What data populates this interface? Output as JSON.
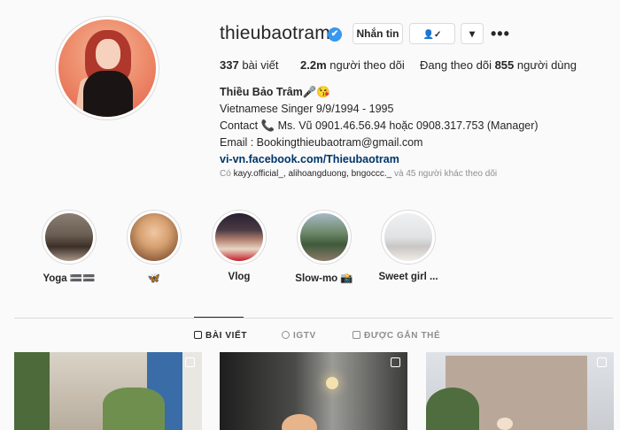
{
  "profile": {
    "username": "thieubaotram",
    "verified_mark": "✔",
    "message_button": "Nhắn tin",
    "follow_icon": "👤✓",
    "dropdown_icon": "▾",
    "more_icon": "•••",
    "stats": {
      "posts_count": "337",
      "posts_label": " bài viết",
      "followers_count": "2.2m",
      "followers_label": " người theo dõi",
      "following_prefix": "Đang theo dõi ",
      "following_count": "855",
      "following_label": " người dùng"
    },
    "bio": {
      "name": "Thiều Bảo Trâm🎤😘",
      "line1": "Vietnamese Singer 9/9/1994 - 1995",
      "line2": "Contact 📞 Ms. Vũ 0901.46.56.94 hoặc 0908.317.753 (Manager)",
      "line3": "Email : Bookingthieubaotram@gmail.com",
      "link": "vi-vn.facebook.com/Thieubaotram"
    },
    "followed_by": {
      "prefix": "Có ",
      "users": "kayy.official_, alihoangduong, bngoccc._",
      "suffix": " và 45 người khác theo dõi"
    }
  },
  "highlights": [
    {
      "label": "Yoga 🟰🟰"
    },
    {
      "label": "🦋"
    },
    {
      "label": "Vlog"
    },
    {
      "label": "Slow-mo 📸"
    },
    {
      "label": "Sweet girl ..."
    }
  ],
  "tabs": {
    "posts": "BÀI VIẾT",
    "igtv": "IGTV",
    "tagged": "ĐƯỢC GẮN THẺ"
  },
  "colors": {
    "accent": "#3897f0",
    "link": "#003569",
    "muted": "#8e8e8e",
    "border": "#dbdbdb"
  }
}
